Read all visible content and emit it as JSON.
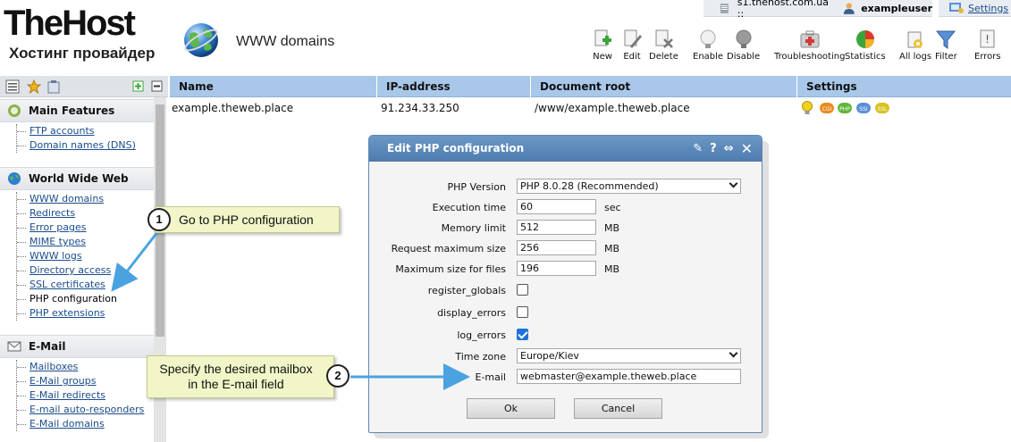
{
  "header": {
    "logo_main": "TheHost",
    "logo_sub": "Хостинг провайдер",
    "page_title": "WWW domains",
    "server": "s1.thehost.com.ua ::",
    "user": "exampleuser",
    "settings_label": "Settings"
  },
  "toolbar": {
    "items": [
      {
        "label": "New",
        "icon": "new-icon"
      },
      {
        "label": "Edit",
        "icon": "edit-icon"
      },
      {
        "label": "Delete",
        "icon": "delete-icon"
      },
      {
        "label": "Enable",
        "icon": "enable-bulb-icon"
      },
      {
        "label": "Disable",
        "icon": "disable-bulb-icon"
      },
      {
        "label": "Troubleshooting",
        "icon": "first-aid-icon"
      },
      {
        "label": "Statistics",
        "icon": "pie-chart-icon"
      },
      {
        "label": "All logs",
        "icon": "logs-icon"
      },
      {
        "label": "Filter",
        "icon": "filter-icon"
      },
      {
        "label": "Errors",
        "icon": "errors-icon"
      }
    ]
  },
  "sidebar": {
    "groups": [
      {
        "title": "Main Features",
        "icon": "main-features-icon",
        "items": [
          "FTP accounts",
          "Domain names (DNS)"
        ]
      },
      {
        "title": "World Wide Web",
        "icon": "globe-icon",
        "items": [
          "WWW domains",
          "Redirects",
          "Error pages",
          "MIME types",
          "WWW logs",
          "Directory access",
          "SSL certificates",
          "PHP configuration",
          "PHP extensions"
        ]
      },
      {
        "title": "E-Mail",
        "icon": "mail-icon",
        "items": [
          "Mailboxes",
          "E-Mail groups",
          "E-Mail redirects",
          "E-mail auto-responders",
          "E-Mail domains"
        ]
      }
    ],
    "active_item": "PHP configuration"
  },
  "table": {
    "columns": [
      "Name",
      "IP-address",
      "Document root",
      "Settings"
    ],
    "rows": [
      {
        "name": "example.theweb.place",
        "ip": "91.234.33.250",
        "docroot": "/www/example.theweb.place",
        "settings": [
          {
            "label": "",
            "icon": "bulb-icon",
            "color": "#f2d21c"
          },
          {
            "label": "CGI",
            "icon": "cgi-icon",
            "color": "#e88b1e"
          },
          {
            "label": "PHP",
            "icon": "php-icon",
            "color": "#5fb43a"
          },
          {
            "label": "SSI",
            "icon": "ssi-icon",
            "color": "#5b8fd6"
          },
          {
            "label": "SSL",
            "icon": "ssl-icon",
            "color": "#d8c21f"
          }
        ]
      }
    ]
  },
  "dialog": {
    "title": "Edit PHP configuration",
    "fields": {
      "php_version": {
        "label": "PHP Version",
        "value": "PHP 8.0.28 (Recommended)"
      },
      "execution_time": {
        "label": "Execution time",
        "value": "60",
        "unit": "sec"
      },
      "memory_limit": {
        "label": "Memory limit",
        "value": "512",
        "unit": "MB"
      },
      "request_max": {
        "label": "Request maximum size",
        "value": "256",
        "unit": "MB"
      },
      "file_max": {
        "label": "Maximum size for files",
        "value": "196",
        "unit": "MB"
      },
      "register_globals": {
        "label": "register_globals",
        "checked": false
      },
      "display_errors": {
        "label": "display_errors",
        "checked": false
      },
      "log_errors": {
        "label": "log_errors",
        "checked": true
      },
      "time_zone": {
        "label": "Time zone",
        "value": "Europe/Kiev"
      },
      "email": {
        "label": "E-mail",
        "value": "webmaster@example.theweb.place"
      }
    },
    "ok_label": "Ok",
    "cancel_label": "Cancel"
  },
  "callouts": [
    {
      "number": "1",
      "text": "Go to PHP configuration"
    },
    {
      "number": "2",
      "text": "Specify the desired mailbox in the E-mail field"
    }
  ],
  "colors": {
    "header_blue": "#a9c8e9",
    "dialog_title": "#5a88b8",
    "callout_bg": "#f1f5c7",
    "arrow": "#4aa3e0",
    "link": "#1a4c8c"
  }
}
